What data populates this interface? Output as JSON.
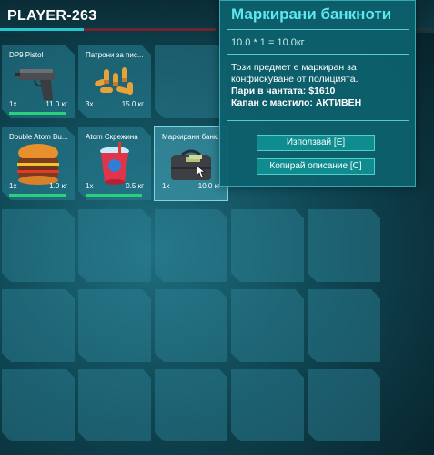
{
  "header": {
    "player": "PLAYER-263"
  },
  "inventory": {
    "items": [
      {
        "name": "DP9 Pistol",
        "qty": "1x",
        "weight": "11.0 кг",
        "icon": "pistol-icon",
        "durability": 1.0
      },
      {
        "name": "Патрони за пис...",
        "qty": "3x",
        "weight": "15.0 кг",
        "icon": "ammo-icon"
      },
      {
        "name": "Double Atom Bu...",
        "qty": "1x",
        "weight": "1.0 кг",
        "icon": "burger-icon",
        "durability": 1.0
      },
      {
        "name": "Atom Скрежина",
        "qty": "1x",
        "weight": "0.5 кг",
        "icon": "slushie-icon",
        "durability": 1.0
      },
      {
        "name": "Маркирани банк...",
        "qty": "1x",
        "weight": "10.0 кг",
        "icon": "money-bag-icon"
      }
    ]
  },
  "tooltip": {
    "title": "Маркирани банкноти",
    "weight_formula": "10.0 * 1 = 10.0кг",
    "description": "Този предмет е маркиран за конфискуване от полицията.",
    "money_line": "Пари в чантата: $1610",
    "dye_line": "Капан с мастило: АКТИВЕН",
    "use_button": "Използвай [E]",
    "copy_button": "Копирай описание [C]"
  },
  "colors": {
    "accent": "#5fe6ee",
    "durability": "#2ad07a",
    "tooltip_bg": "#0c606c"
  }
}
